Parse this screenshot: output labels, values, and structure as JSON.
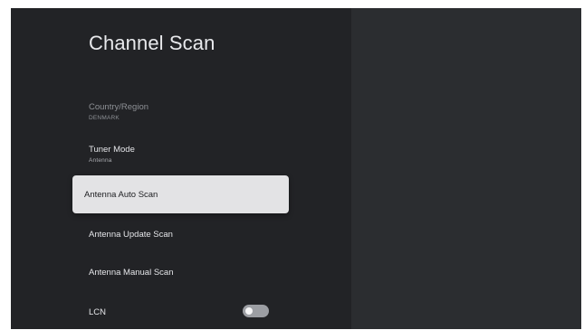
{
  "header": {
    "title": "Channel Scan"
  },
  "menu": {
    "items": [
      {
        "label": "Country/Region",
        "value": "DENMARK",
        "state": "disabled"
      },
      {
        "label": "Tuner Mode",
        "value": "Antenna",
        "state": "normal"
      },
      {
        "label": "Antenna Auto Scan",
        "state": "focused"
      },
      {
        "label": "Antenna Update Scan",
        "state": "normal"
      },
      {
        "label": "Antenna Manual Scan",
        "state": "normal"
      },
      {
        "label": "LCN",
        "state": "normal",
        "toggle": "off"
      }
    ]
  },
  "colors": {
    "background": "#2b2d30",
    "panel": "#222326",
    "focus_highlight": "#e3e3e5",
    "text_primary": "#e4e5e8",
    "text_disabled": "#8d9095"
  }
}
